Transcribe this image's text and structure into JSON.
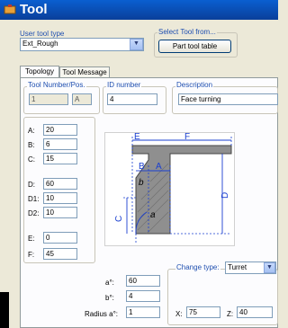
{
  "window": {
    "title": "Tool"
  },
  "user_tool_type": {
    "label": "User tool type",
    "value": "Ext_Rough"
  },
  "select_tool_from": {
    "label": "Select Tool from...",
    "button": "Part tool table"
  },
  "tabs": [
    "Topology",
    "Tool Message"
  ],
  "tool_number": {
    "label": "Tool Number/Pos.",
    "value": "1",
    "pos": "A"
  },
  "id_number": {
    "label": "ID number",
    "value": "4"
  },
  "description": {
    "label": "Description",
    "value": "Face turning"
  },
  "params_a": [
    {
      "label": "A:",
      "value": "20"
    },
    {
      "label": "B:",
      "value": "6"
    },
    {
      "label": "C:",
      "value": "15"
    }
  ],
  "params_d": [
    {
      "label": "D:",
      "value": "60"
    },
    {
      "label": "D1:",
      "value": "10"
    },
    {
      "label": "D2:",
      "value": "10"
    }
  ],
  "params_e": [
    {
      "label": "E:",
      "value": "0"
    },
    {
      "label": "F:",
      "value": "45"
    }
  ],
  "bottom_params": [
    {
      "label": "a°:",
      "value": "60"
    },
    {
      "label": "b°:",
      "value": "4"
    },
    {
      "label": "Radius a°:",
      "value": "1"
    }
  ],
  "change_type": {
    "label": "Change type:",
    "value": "Turret",
    "x_label": "X:",
    "x_value": "75",
    "z_label": "Z:",
    "z_value": "40"
  },
  "diagram_labels": {
    "e": "E",
    "f": "F",
    "b": "B",
    "a": "A",
    "d": "D",
    "c": "C",
    "b_small": "b",
    "alpha": "a"
  },
  "colors": {
    "title_bar": "#0a4fc0",
    "dimension": "#1a3fd0",
    "tool_body": "#8f8f8f"
  },
  "icons": {
    "combo_arrow": "chevron-down-icon",
    "app": "tool-icon"
  }
}
